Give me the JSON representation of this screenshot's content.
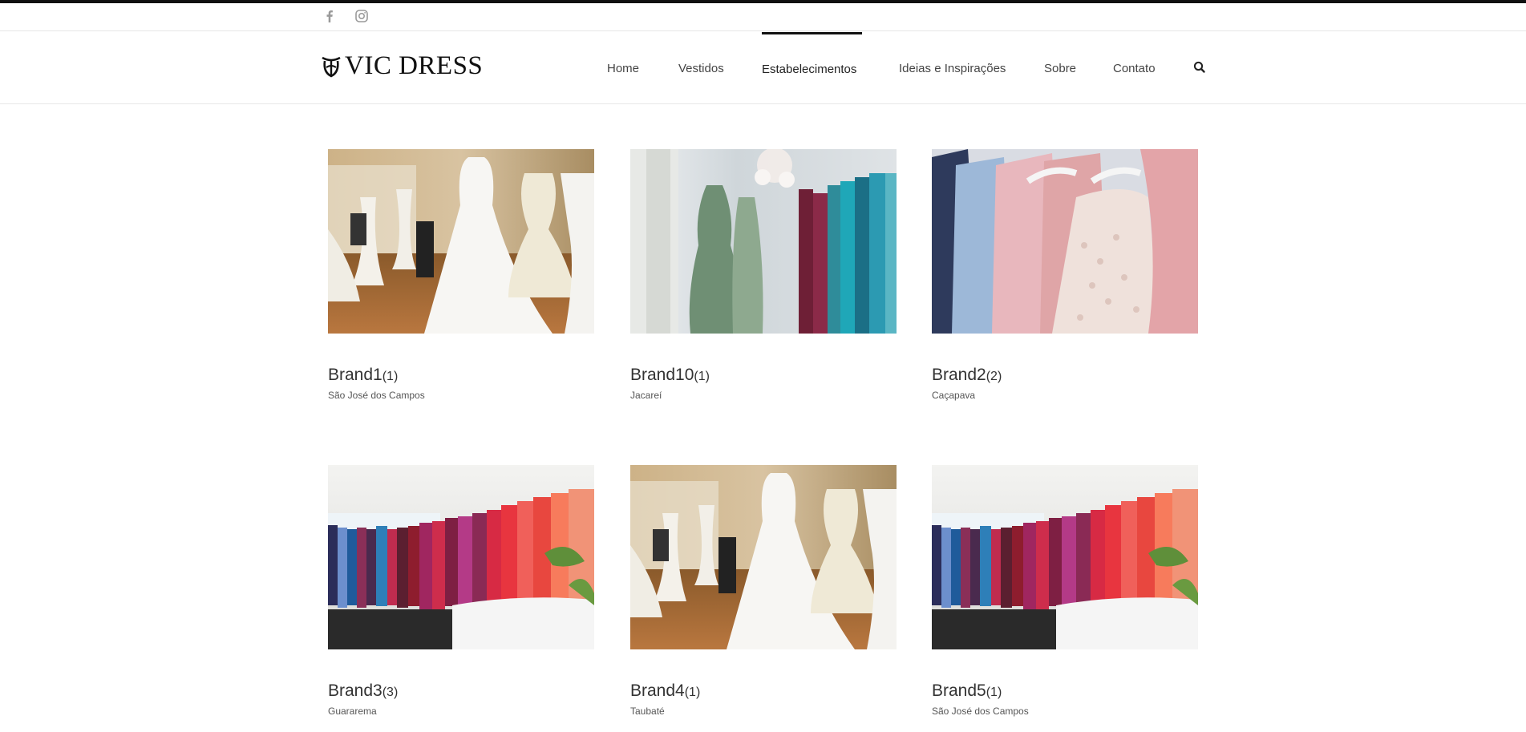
{
  "social": {
    "icons": [
      "facebook-icon",
      "instagram-icon"
    ]
  },
  "brand": {
    "logo_text": "VIC DRESS"
  },
  "nav": {
    "items": [
      {
        "label": "Home"
      },
      {
        "label": "Vestidos"
      },
      {
        "label": "Estabelecimentos",
        "active": true
      },
      {
        "label": "Ideias e Inspirações"
      },
      {
        "label": "Sobre"
      },
      {
        "label": "Contato"
      }
    ],
    "search_icon": "search-icon"
  },
  "listings": [
    {
      "name": "Brand1",
      "count": "(1)",
      "city": "São José dos Campos",
      "photo": "bridal-showroom"
    },
    {
      "name": "Brand10",
      "count": "(1)",
      "city": "Jacareí",
      "photo": "gown-rack-chandelier"
    },
    {
      "name": "Brand2",
      "count": "(2)",
      "city": "Caçapava",
      "photo": "pastel-dresses-hangers"
    },
    {
      "name": "Brand3",
      "count": "(3)",
      "city": "Guararema",
      "photo": "colorful-dress-rack"
    },
    {
      "name": "Brand4",
      "count": "(1)",
      "city": "Taubaté",
      "photo": "bridal-showroom"
    },
    {
      "name": "Brand5",
      "count": "(1)",
      "city": "São José dos Campos",
      "photo": "colorful-dress-rack"
    }
  ],
  "colors": {
    "text": "#333333",
    "border": "#111111",
    "muted": "#999999"
  }
}
